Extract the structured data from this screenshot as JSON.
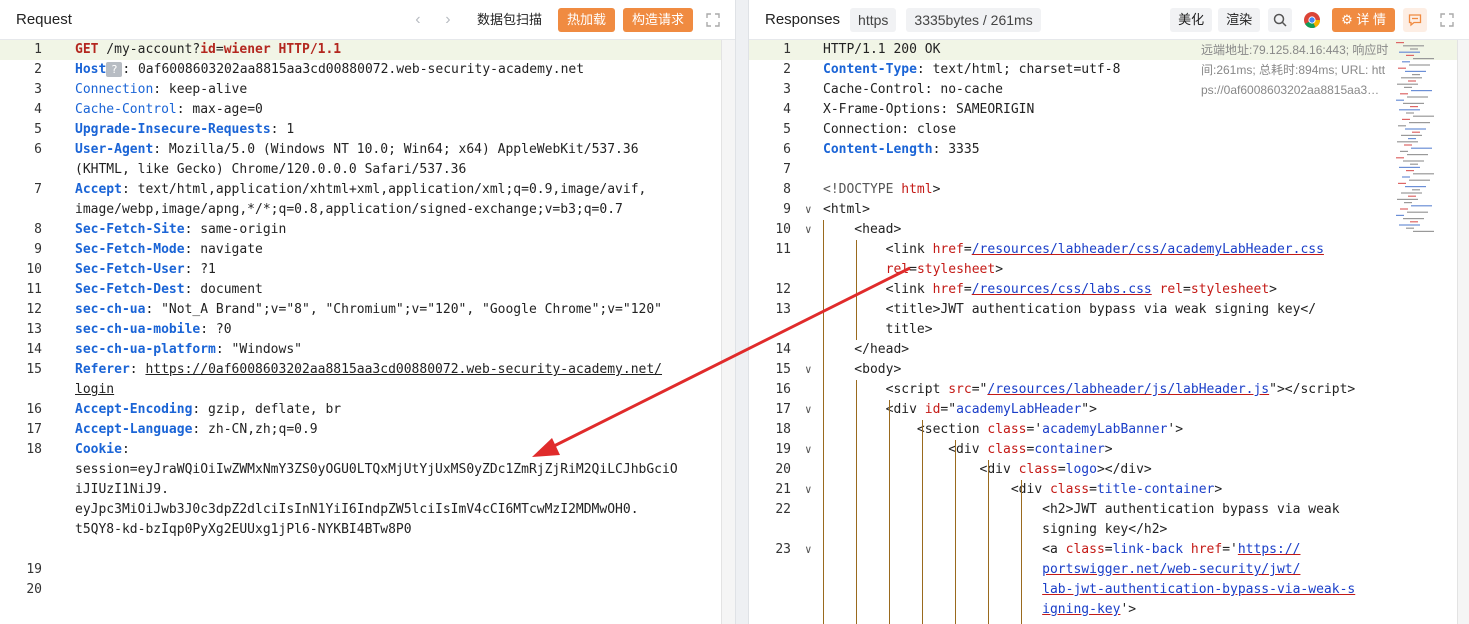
{
  "request": {
    "title": "Request",
    "nav_prev": "‹",
    "nav_next": "›",
    "scan_label": "数据包扫描",
    "hot_load_label": "热加载",
    "build_label": "构造请求",
    "lines": [
      {
        "n": "1",
        "html": "<span class='kw'>GET</span> /my-account?<span class='kw'>id</span>=<span class='kw'>wiener</span> <span class='kw'>HTTP/1.1</span>"
      },
      {
        "n": "2",
        "html": "<span class='hn'>Host</span><span style='display:inline-block;width:16px;height:15px;background:#b7bcc3;color:#fff;border-radius:2px;text-align:center;line-height:15px;font-size:11px;vertical-align:middle;'>?</span>: 0af6008603202aa8815aa3cd00880072.web-security-academy.net"
      },
      {
        "n": "3",
        "html": "<span class='hn' style='font-weight:normal'>Connection</span>: keep-alive"
      },
      {
        "n": "4",
        "html": "<span class='hn' style='font-weight:normal'>Cache-Control</span>: max-age=0"
      },
      {
        "n": "5",
        "html": "<span class='hn'>Upgrade-Insecure-Requests</span>: 1"
      },
      {
        "n": "6",
        "html": "<span class='hn'>User-Agent</span>: Mozilla/5.0 (Windows NT 10.0; Win64; x64) AppleWebKit/537.36"
      },
      {
        "n": "",
        "html": "(KHTML, like Gecko) Chrome/120.0.0.0 Safari/537.36"
      },
      {
        "n": "7",
        "html": "<span class='hn'>Accept</span>: text/html,application/xhtml+xml,application/xml;q=0.9,image/avif,"
      },
      {
        "n": "",
        "html": "image/webp,image/apng,*/*;q=0.8,application/signed-exchange;v=b3;q=0.7"
      },
      {
        "n": "8",
        "html": "<span class='hn'>Sec-Fetch-Site</span>: same-origin"
      },
      {
        "n": "9",
        "html": "<span class='hn'>Sec-Fetch-Mode</span>: navigate"
      },
      {
        "n": "10",
        "html": "<span class='hn'>Sec-Fetch-User</span>: ?1"
      },
      {
        "n": "11",
        "html": "<span class='hn'>Sec-Fetch-Dest</span>: document"
      },
      {
        "n": "12",
        "html": "<span class='hn'>sec-ch-ua</span>: \"Not_A Brand\";v=\"8\", \"Chromium\";v=\"120\", \"Google Chrome\";v=\"120\""
      },
      {
        "n": "13",
        "html": "<span class='hn'>sec-ch-ua-mobile</span>: ?0"
      },
      {
        "n": "14",
        "html": "<span class='hn'>sec-ch-ua-platform</span>: \"Windows\""
      },
      {
        "n": "15",
        "html": "<span class='hn'>Referer</span>: <span class='ul'>https://0af6008603202aa8815aa3cd00880072.web-security-academy.net/</span>"
      },
      {
        "n": "",
        "html": "<span class='ul'>login</span>"
      },
      {
        "n": "16",
        "html": "<span class='hn'>Accept-Encoding</span>: gzip, deflate, br"
      },
      {
        "n": "17",
        "html": "<span class='hn'>Accept-Language</span>: zh-CN,zh;q=0.9"
      },
      {
        "n": "18",
        "html": "<span class='hn'>Cookie</span>:"
      },
      {
        "n": "",
        "html": "session=eyJraWQiOiIwZWMxNmY3ZS0yOGU0LTQxMjUtYjUxMS0yZDc1ZmRjZjRiM2QiLCJhbGciO"
      },
      {
        "n": "",
        "html": "iJIUzI1NiJ9."
      },
      {
        "n": "",
        "html": "eyJpc3MiOiJwb3J0c3dpZ2dlciIsInN1YiI6IndpZW5lciIsImV4cCI6MTcwMzI2MDMwOH0."
      },
      {
        "n": "",
        "html": "t5QY8-kd-bzIqp0PyXg2EUUxg1jPl6-NYKBI4BTw8P0"
      },
      {
        "n": "",
        "html": ""
      },
      {
        "n": "19",
        "html": ""
      },
      {
        "n": "20",
        "html": ""
      }
    ]
  },
  "response": {
    "title": "Responses",
    "protocol_chip": "https",
    "size_chip": "3335bytes / 261ms",
    "beautify_label": "美化",
    "render_label": "渲染",
    "detail_label": "详 情",
    "meta_text": "远端地址:79.125.84.16:443; 响应时间:261ms; 总耗时:894ms; URL: https://0af6008603202aa8815aa3…",
    "lines": [
      {
        "n": "1",
        "fold": "",
        "html": "HTTP/1.1 200 OK"
      },
      {
        "n": "2",
        "fold": "",
        "html": "<span class='hn'>Content-Type</span>: text/html; charset=utf-8"
      },
      {
        "n": "3",
        "fold": "",
        "html": "Cache-Control: no-cache"
      },
      {
        "n": "4",
        "fold": "",
        "html": "X-Frame-Options: SAMEORIGIN"
      },
      {
        "n": "5",
        "fold": "",
        "html": "Connection: close"
      },
      {
        "n": "6",
        "fold": "",
        "html": "<span class='hn'>Content-Length</span>: 3335"
      },
      {
        "n": "7",
        "fold": "",
        "html": ""
      },
      {
        "n": "8",
        "fold": "",
        "html": "<span class='muted'>&lt;!DOCTYPE</span> <span class='at'>html</span>&gt;"
      },
      {
        "n": "9",
        "fold": "∨",
        "html": "&lt;html&gt;"
      },
      {
        "n": "10",
        "fold": "∨",
        "html": "    &lt;head&gt;"
      },
      {
        "n": "11",
        "fold": "",
        "html": "        &lt;link <span class='at'>href</span>=<span class='vl'>/resources/labheader/css/academyLabHeader.css</span>"
      },
      {
        "n": "",
        "fold": "",
        "html": "        <span class='at'>rel</span>=<span class='at'>stylesheet</span>&gt;"
      },
      {
        "n": "12",
        "fold": "",
        "html": "        &lt;link <span class='at'>href</span>=<span class='vl'>/resources/css/labs.css</span> <span class='at'>rel</span>=<span class='at'>stylesheet</span>&gt;"
      },
      {
        "n": "13",
        "fold": "",
        "html": "        &lt;title&gt;JWT authentication bypass via weak signing key&lt;/"
      },
      {
        "n": "",
        "fold": "",
        "html": "        title&gt;"
      },
      {
        "n": "14",
        "fold": "",
        "html": "    &lt;/head&gt;"
      },
      {
        "n": "15",
        "fold": "∨",
        "html": "    &lt;body&gt;"
      },
      {
        "n": "16",
        "fold": "",
        "html": "        &lt;script <span class='at'>src</span>=\"<span class='vl'>/resources/labheader/js/labHeader.js</span>\"&gt;&lt;/script&gt;"
      },
      {
        "n": "17",
        "fold": "∨",
        "html": "        &lt;div <span class='at'>id</span>=\"<span style='color:#1a3ec8'>academyLabHeader</span>\"&gt;"
      },
      {
        "n": "18",
        "fold": "",
        "html": "            &lt;section <span class='at'>class</span>='<span style='color:#1a3ec8'>academyLabBanner</span>'&gt;"
      },
      {
        "n": "19",
        "fold": "∨",
        "html": "                &lt;div <span class='at'>class</span>=<span style='color:#1a3ec8'>container</span>&gt;"
      },
      {
        "n": "20",
        "fold": "",
        "html": "                    &lt;div <span class='at'>class</span>=<span style='color:#1a3ec8'>logo</span>&gt;&lt;/div&gt;"
      },
      {
        "n": "21",
        "fold": "∨",
        "html": "                        &lt;div <span class='at'>class</span>=<span style='color:#1a3ec8'>title-container</span>&gt;"
      },
      {
        "n": "22",
        "fold": "",
        "html": "                            &lt;h2&gt;JWT authentication bypass via weak"
      },
      {
        "n": "",
        "fold": "",
        "html": "                            signing key&lt;/h2&gt;"
      },
      {
        "n": "23",
        "fold": "∨",
        "html": "                            &lt;a <span class='at'>class</span>=<span style='color:#1a3ec8'>link-back</span> <span class='at'>href</span>='<span class='vl'>https://</span>"
      },
      {
        "n": "",
        "fold": "",
        "html": "                            <span class='vl'>portswigger.net/web-security/jwt/</span>"
      },
      {
        "n": "",
        "fold": "",
        "html": "                            <span class='vl'>lab-jwt-authentication-bypass-via-weak-s</span>"
      },
      {
        "n": "",
        "fold": "",
        "html": "                            <span class='vl'>igning-key</span>'&gt;"
      }
    ]
  }
}
